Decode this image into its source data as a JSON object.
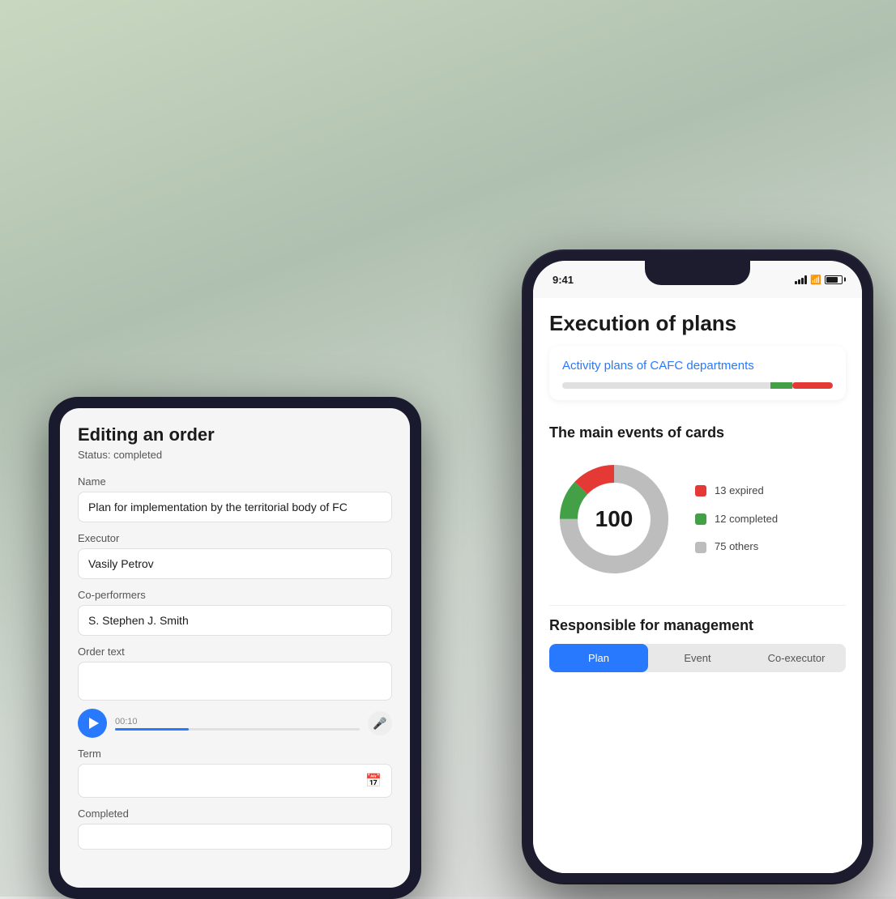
{
  "background": {
    "color": "#c8d8c0"
  },
  "android": {
    "title": "Editing an order",
    "status": "Status: completed",
    "fields": {
      "name_label": "Name",
      "name_value": "Plan for implementation by the territorial body of FC",
      "executor_label": "Executor",
      "executor_value": "Vasily Petrov",
      "co_performers_label": "Co-performers",
      "co_performers_value": "S. Stephen   J. Smith",
      "order_text_label": "Order text",
      "order_text_value": "",
      "audio_time": "00:10",
      "term_label": "Term",
      "term_value": "",
      "completed_label": "Completed"
    }
  },
  "iphone": {
    "status_bar": {
      "time": "9:41"
    },
    "page_title": "Execution of plans",
    "plan_card": {
      "title": "Activity plans of CAFC departments",
      "progress_red_pct": 15,
      "progress_green_pct": 8
    },
    "events_section": {
      "title": "The main events of cards",
      "donut_center": "100",
      "legend": [
        {
          "color": "#e53935",
          "label": "13 expired"
        },
        {
          "color": "#43a047",
          "label": "12 completed"
        },
        {
          "color": "#bdbdbd",
          "label": "75 others"
        }
      ]
    },
    "responsible_section": {
      "title": "Responsible for management",
      "tabs": [
        "Plan",
        "Event",
        "Co-executor"
      ],
      "active_tab": 0
    }
  }
}
